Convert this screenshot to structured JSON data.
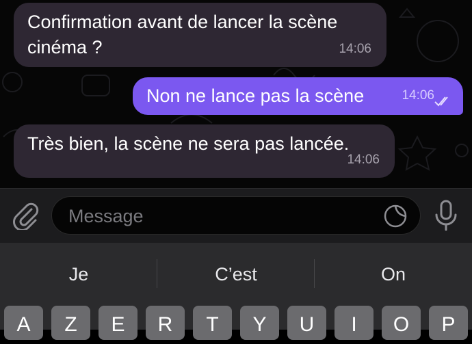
{
  "messages": [
    {
      "direction": "incoming",
      "text": "Confirmation avant de lancer la scène cinéma ?",
      "time": "14:06"
    },
    {
      "direction": "outgoing",
      "text": "Non ne lance pas la scène",
      "time": "14:06",
      "status_icon": "double-check-icon"
    },
    {
      "direction": "incoming",
      "text": "Très bien, la scène ne sera pas lancée.",
      "time": "14:06"
    }
  ],
  "composer": {
    "placeholder": "Message",
    "attach_icon": "paperclip-icon",
    "sticker_icon": "sticker-icon",
    "mic_icon": "microphone-icon"
  },
  "keyboard": {
    "suggestions": [
      "Je",
      "C’est",
      "On"
    ],
    "row1": [
      "A",
      "Z",
      "E",
      "R",
      "T",
      "Y",
      "U",
      "I",
      "O",
      "P"
    ]
  },
  "colors": {
    "outgoing_bubble": "#7b58f0",
    "incoming_bubble": "#2e2733",
    "chat_background": "#060606",
    "keyboard_background": "#2b2b2d"
  }
}
